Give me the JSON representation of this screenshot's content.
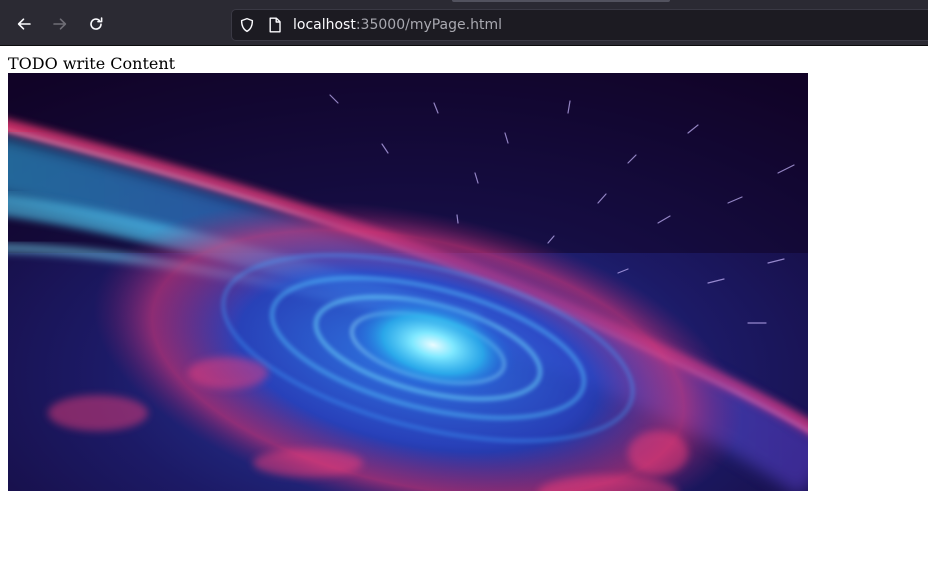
{
  "browser": {
    "url": {
      "host": "localhost",
      "rest": ":35000/myPage.html"
    },
    "icons": {
      "back": "back-arrow-icon",
      "forward": "forward-arrow-icon",
      "reload": "reload-icon",
      "site_info": "shield-icon",
      "page": "page-icon"
    },
    "forward_enabled": false
  },
  "page": {
    "text": "TODO write Content",
    "image": {
      "subject": "spiral-galaxy",
      "colors": {
        "space": "#14042e",
        "cyan": "#3fd2ff",
        "blue": "#2a4fd8",
        "magenta": "#ff3b78"
      }
    }
  },
  "colors": {
    "toolbar": "#2b2a33",
    "urlbar": "#1c1b22",
    "icon": "#fbfbfe",
    "icon_disabled": "#6f6e76"
  }
}
